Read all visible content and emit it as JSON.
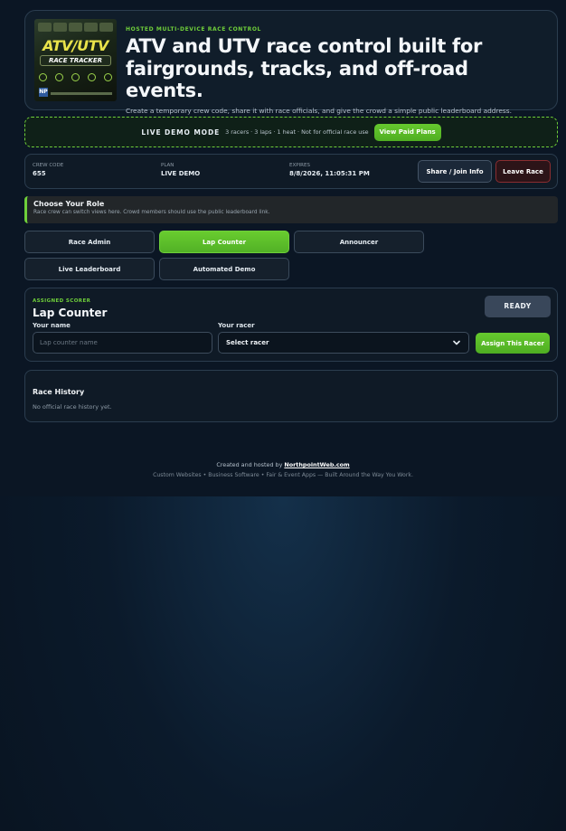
{
  "hero": {
    "logo": {
      "title": "ATV/UTV",
      "subtitle": "RACE TRACKER",
      "brand_mark": "NP"
    },
    "eyebrow": "HOSTED MULTI-DEVICE RACE CONTROL",
    "title": "ATV and UTV race control built for fairgrounds, tracks, and off-road events.",
    "description": "Create a temporary crew code, share it with race officials, and give the crowd a simple public leaderboard address."
  },
  "demo": {
    "label": "LIVE DEMO MODE",
    "info": "3 racers · 3 laps · 1 heat · Not for official race use",
    "button": "View Paid Plans"
  },
  "session": {
    "crew_code_label": "CREW CODE",
    "crew_code": "655",
    "plan_label": "PLAN",
    "plan": "LIVE DEMO",
    "expires_label": "EXPIRES",
    "expires": "8/8/2026, 11:05:31 PM",
    "share_button": "Share / Join Info",
    "leave_button": "Leave Race"
  },
  "roles": {
    "title": "Choose Your Role",
    "help": "Race crew can switch views here. Crowd members should use the public leaderboard link.",
    "items": [
      {
        "label": "Race Admin",
        "active": false
      },
      {
        "label": "Lap Counter",
        "active": true
      },
      {
        "label": "Announcer",
        "active": false
      },
      {
        "label": "Live Leaderboard",
        "active": false
      },
      {
        "label": "Automated Demo",
        "active": false
      }
    ]
  },
  "scorer": {
    "eyebrow": "ASSIGNED SCORER",
    "title": "Lap Counter",
    "status": "READY",
    "name_label": "Your name",
    "name_placeholder": "Lap counter name",
    "racer_label": "Your racer",
    "racer_selected": "Select racer",
    "assign_button": "Assign This Racer"
  },
  "history": {
    "title": "Race History",
    "empty": "No official race history yet."
  },
  "footer": {
    "credit_prefix": "Created and hosted by ",
    "credit_link": "NorthpointWeb.com",
    "tagline": "Custom Websites • Business Software • Fair & Event Apps — Built Around the Way You Work."
  },
  "colors": {
    "accent_green": "#6fcf3a",
    "danger": "#8a2d30",
    "panel": "#0f1a26"
  },
  "icons": [
    "chevron-down-icon",
    "stopwatch-icon",
    "flag-icon"
  ]
}
